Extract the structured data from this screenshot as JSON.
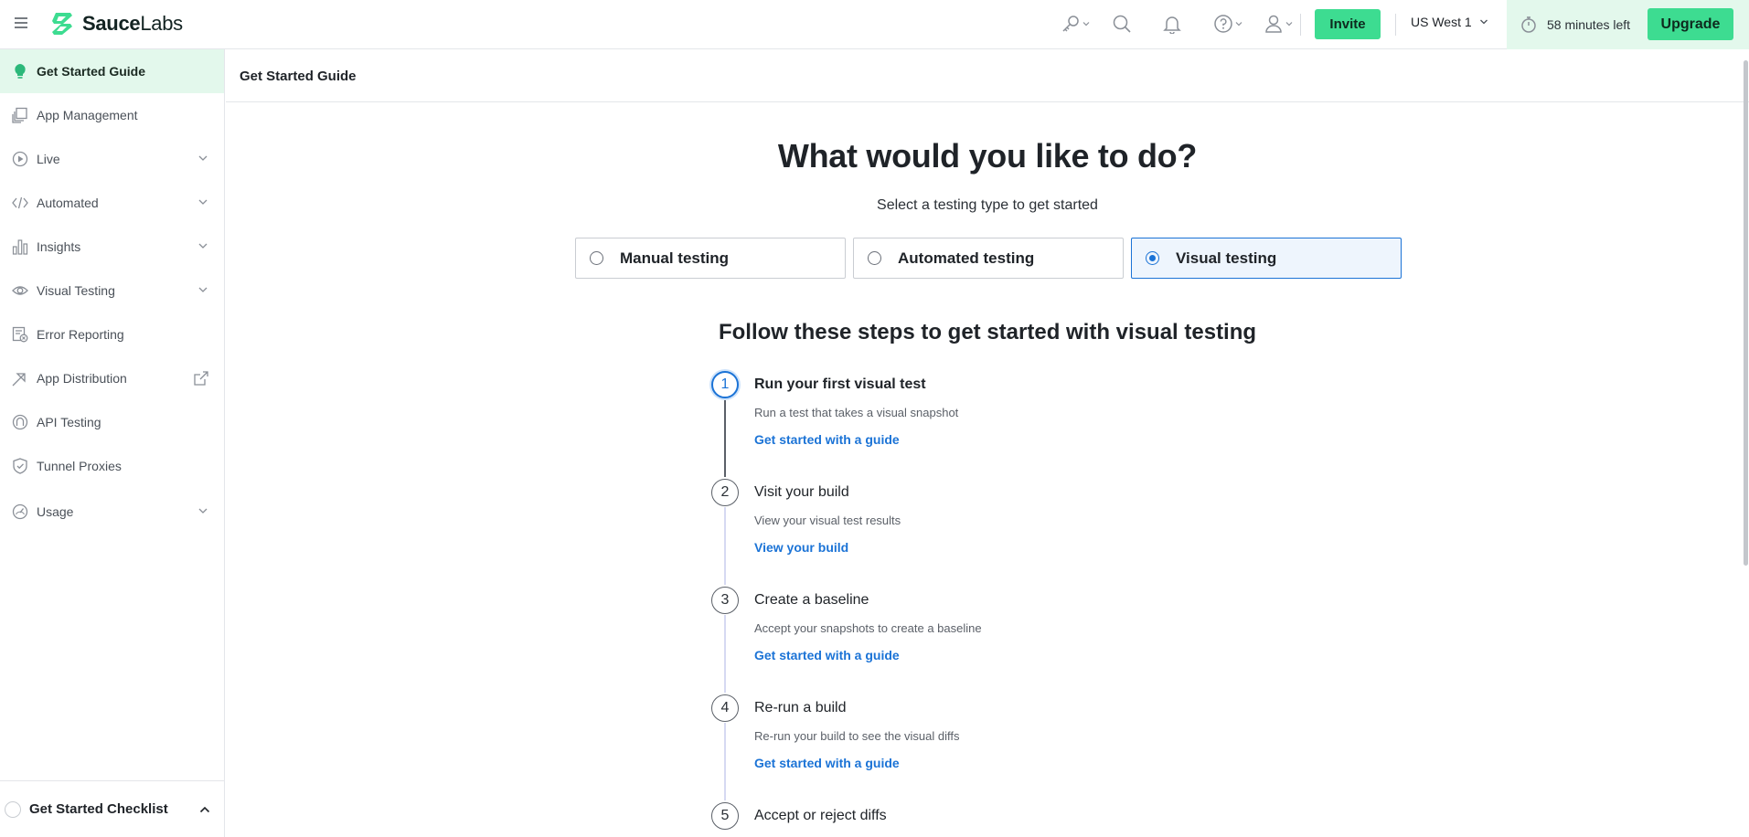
{
  "app": {
    "brand_strong": "Sauce",
    "brand_light": "Labs"
  },
  "topbar": {
    "icons": [
      "key-icon",
      "search-icon",
      "bell-icon",
      "help-icon",
      "user-icon"
    ],
    "invite_label": "Invite",
    "region_label": "US West 1",
    "trial_time_label": "58 minutes left",
    "upgrade_label": "Upgrade"
  },
  "sidebar": {
    "items": [
      {
        "label": "Get Started Guide",
        "icon": "lightbulb-icon",
        "active": true
      },
      {
        "label": "App Management",
        "icon": "app-management-icon"
      },
      {
        "label": "Live",
        "icon": "play-icon",
        "expandable": true
      },
      {
        "label": "Automated",
        "icon": "code-icon",
        "expandable": true
      },
      {
        "label": "Insights",
        "icon": "bar-chart-icon",
        "expandable": true
      },
      {
        "label": "Visual Testing",
        "icon": "eye-icon",
        "expandable": true
      },
      {
        "label": "Error Reporting",
        "icon": "error-report-icon"
      },
      {
        "label": "App Distribution",
        "icon": "distribution-icon",
        "external": true
      },
      {
        "label": "API Testing",
        "icon": "api-icon"
      },
      {
        "label": "Tunnel Proxies",
        "icon": "shield-icon"
      },
      {
        "label": "Usage",
        "icon": "gauge-icon",
        "expandable": true
      }
    ],
    "checklist_label": "Get Started Checklist"
  },
  "main": {
    "page_title": "Get Started Guide",
    "hero_title": "What would you like to do?",
    "hero_subtitle": "Select a testing type to get started",
    "options": [
      {
        "label": "Manual testing",
        "selected": false
      },
      {
        "label": "Automated testing",
        "selected": false
      },
      {
        "label": "Visual testing",
        "selected": true
      }
    ],
    "steps_title": "Follow these steps to get started with visual testing",
    "steps": [
      {
        "number": "1",
        "title": "Run your first visual test",
        "description": "Run a test that takes a visual snapshot",
        "link": "Get started with a guide",
        "active": true
      },
      {
        "number": "2",
        "title": "Visit your build",
        "description": "View your visual test results",
        "link": "View your build"
      },
      {
        "number": "3",
        "title": "Create a baseline",
        "description": "Accept your snapshots to create a baseline",
        "link": "Get started with a guide"
      },
      {
        "number": "4",
        "title": "Re-run a build",
        "description": "Re-run your build to see the visual diffs",
        "link": "Get started with a guide"
      },
      {
        "number": "5",
        "title": "Accept or reject diffs",
        "description": "",
        "link": ""
      }
    ]
  }
}
